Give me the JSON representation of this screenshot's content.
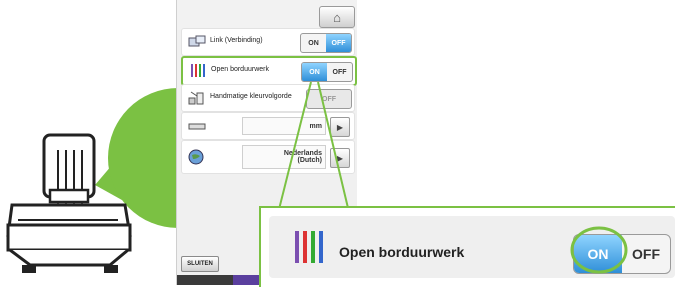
{
  "colors": {
    "callout_green": "#7bc143",
    "toggle_on": "#2f8fd8",
    "highlight": "#7bc143"
  },
  "screen": {
    "home_icon": "home-icon",
    "rows": [
      {
        "label": "Link (Verbinding)",
        "icon": "link-icon",
        "toggle": {
          "on": "ON",
          "off": "OFF",
          "selected": "OFF"
        }
      },
      {
        "label": "Open borduurwerk",
        "icon": "needles-icon",
        "toggle": {
          "on": "ON",
          "off": "OFF",
          "selected": "ON"
        }
      },
      {
        "label": "Handmatige kleurvolgorde",
        "icon": "color-order-icon",
        "toggle": {
          "off": "OFF"
        }
      },
      {
        "label": "",
        "icon": "ruler-icon",
        "value": "mm",
        "arrow": "▶"
      },
      {
        "label": "",
        "icon": "globe-icon",
        "value_line1": "Nederlands",
        "value_line2": "(Dutch)",
        "arrow": "▶"
      }
    ],
    "close_label": "SLUITEN"
  },
  "callout": {
    "label": "Open borduurwerk",
    "on": "ON",
    "off": "OFF",
    "selected": "ON"
  }
}
